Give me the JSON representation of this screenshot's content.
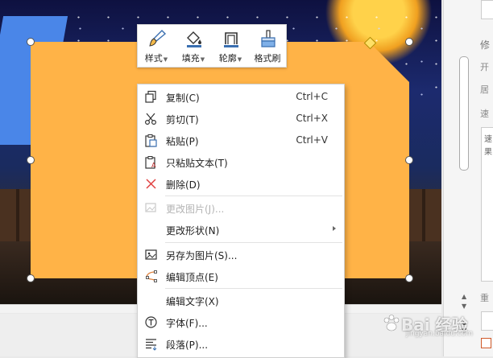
{
  "toolbar": {
    "items": [
      {
        "label": "样式",
        "icon": "brush-icon",
        "has_dropdown": true
      },
      {
        "label": "填充",
        "icon": "fill-bucket-icon",
        "has_dropdown": true
      },
      {
        "label": "轮廓",
        "icon": "outline-icon",
        "has_dropdown": true
      },
      {
        "label": "格式刷",
        "icon": "format-painter-icon",
        "has_dropdown": false
      }
    ]
  },
  "context_menu": {
    "items": [
      {
        "label": "复制(C)",
        "shortcut": "Ctrl+C",
        "icon": "copy-icon",
        "enabled": true
      },
      {
        "label": "剪切(T)",
        "shortcut": "Ctrl+X",
        "icon": "scissors-icon",
        "enabled": true
      },
      {
        "label": "粘贴(P)",
        "shortcut": "Ctrl+V",
        "icon": "paste-icon",
        "enabled": true
      },
      {
        "label": "只粘贴文本(T)",
        "shortcut": "",
        "icon": "paste-text-icon",
        "enabled": true
      },
      {
        "label": "删除(D)",
        "shortcut": "",
        "icon": "delete-x-icon",
        "enabled": true
      },
      {
        "label": "更改图片(J)...",
        "shortcut": "",
        "icon": "change-picture-icon",
        "enabled": false
      },
      {
        "label": "更改形状(N)",
        "shortcut": "",
        "icon": "",
        "enabled": true,
        "submenu": true
      },
      {
        "label": "另存为图片(S)...",
        "shortcut": "",
        "icon": "save-as-picture-icon",
        "enabled": true
      },
      {
        "label": "编辑顶点(E)",
        "shortcut": "",
        "icon": "edit-points-icon",
        "enabled": true
      },
      {
        "label": "编辑文字(X)",
        "shortcut": "",
        "icon": "",
        "enabled": true
      },
      {
        "label": "字体(F)...",
        "shortcut": "",
        "icon": "font-icon",
        "enabled": true
      },
      {
        "label": "段落(P)...",
        "shortcut": "",
        "icon": "paragraph-icon",
        "enabled": true
      }
    ]
  },
  "right_panel": {
    "labels": [
      "修",
      "开",
      "居",
      "速",
      "速",
      "果",
      "重"
    ]
  },
  "watermark": {
    "text": "Bai 经验",
    "sub": "jingyan.baidu.com"
  },
  "colors": {
    "shape_fill": "#FFB347",
    "menu_bg": "#FFFFFF",
    "accent_delete": "#E04040"
  }
}
